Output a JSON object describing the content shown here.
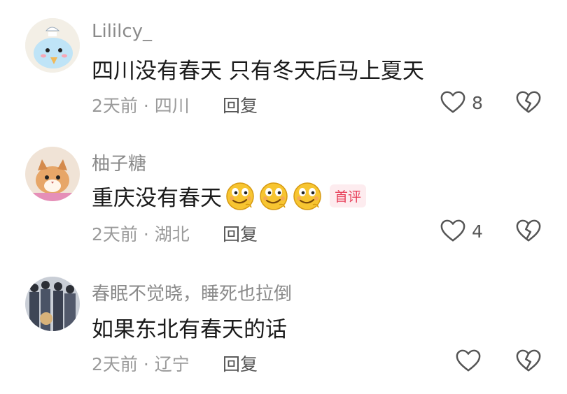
{
  "comments": [
    {
      "username": "Lililcy_",
      "text": "四川没有春天 只有冬天后马上夏天",
      "time_location": "2天前 · 四川",
      "reply_label": "回复",
      "likes": "8",
      "avatar_icon": "cartoon-whale-avatar-icon"
    },
    {
      "username": "柚子糖",
      "text": "重庆没有春天",
      "emoji_icons": [
        "smirk-emoji-icon",
        "smirk-emoji-icon",
        "smirk-emoji-icon"
      ],
      "badge": "首评",
      "time_location": "2天前 · 湖北",
      "reply_label": "回复",
      "likes": "4",
      "avatar_icon": "kitten-avatar-icon"
    },
    {
      "username": "春眠不觉晓，睡死也拉倒",
      "text": "如果东北有春天的话",
      "time_location": "2天前 · 辽宁",
      "reply_label": "回复",
      "likes": "",
      "avatar_icon": "group-photo-avatar-icon"
    }
  ],
  "colors": {
    "username": "#8a8a8a",
    "meta": "#9a9a9a",
    "badge": "#e8405a"
  }
}
